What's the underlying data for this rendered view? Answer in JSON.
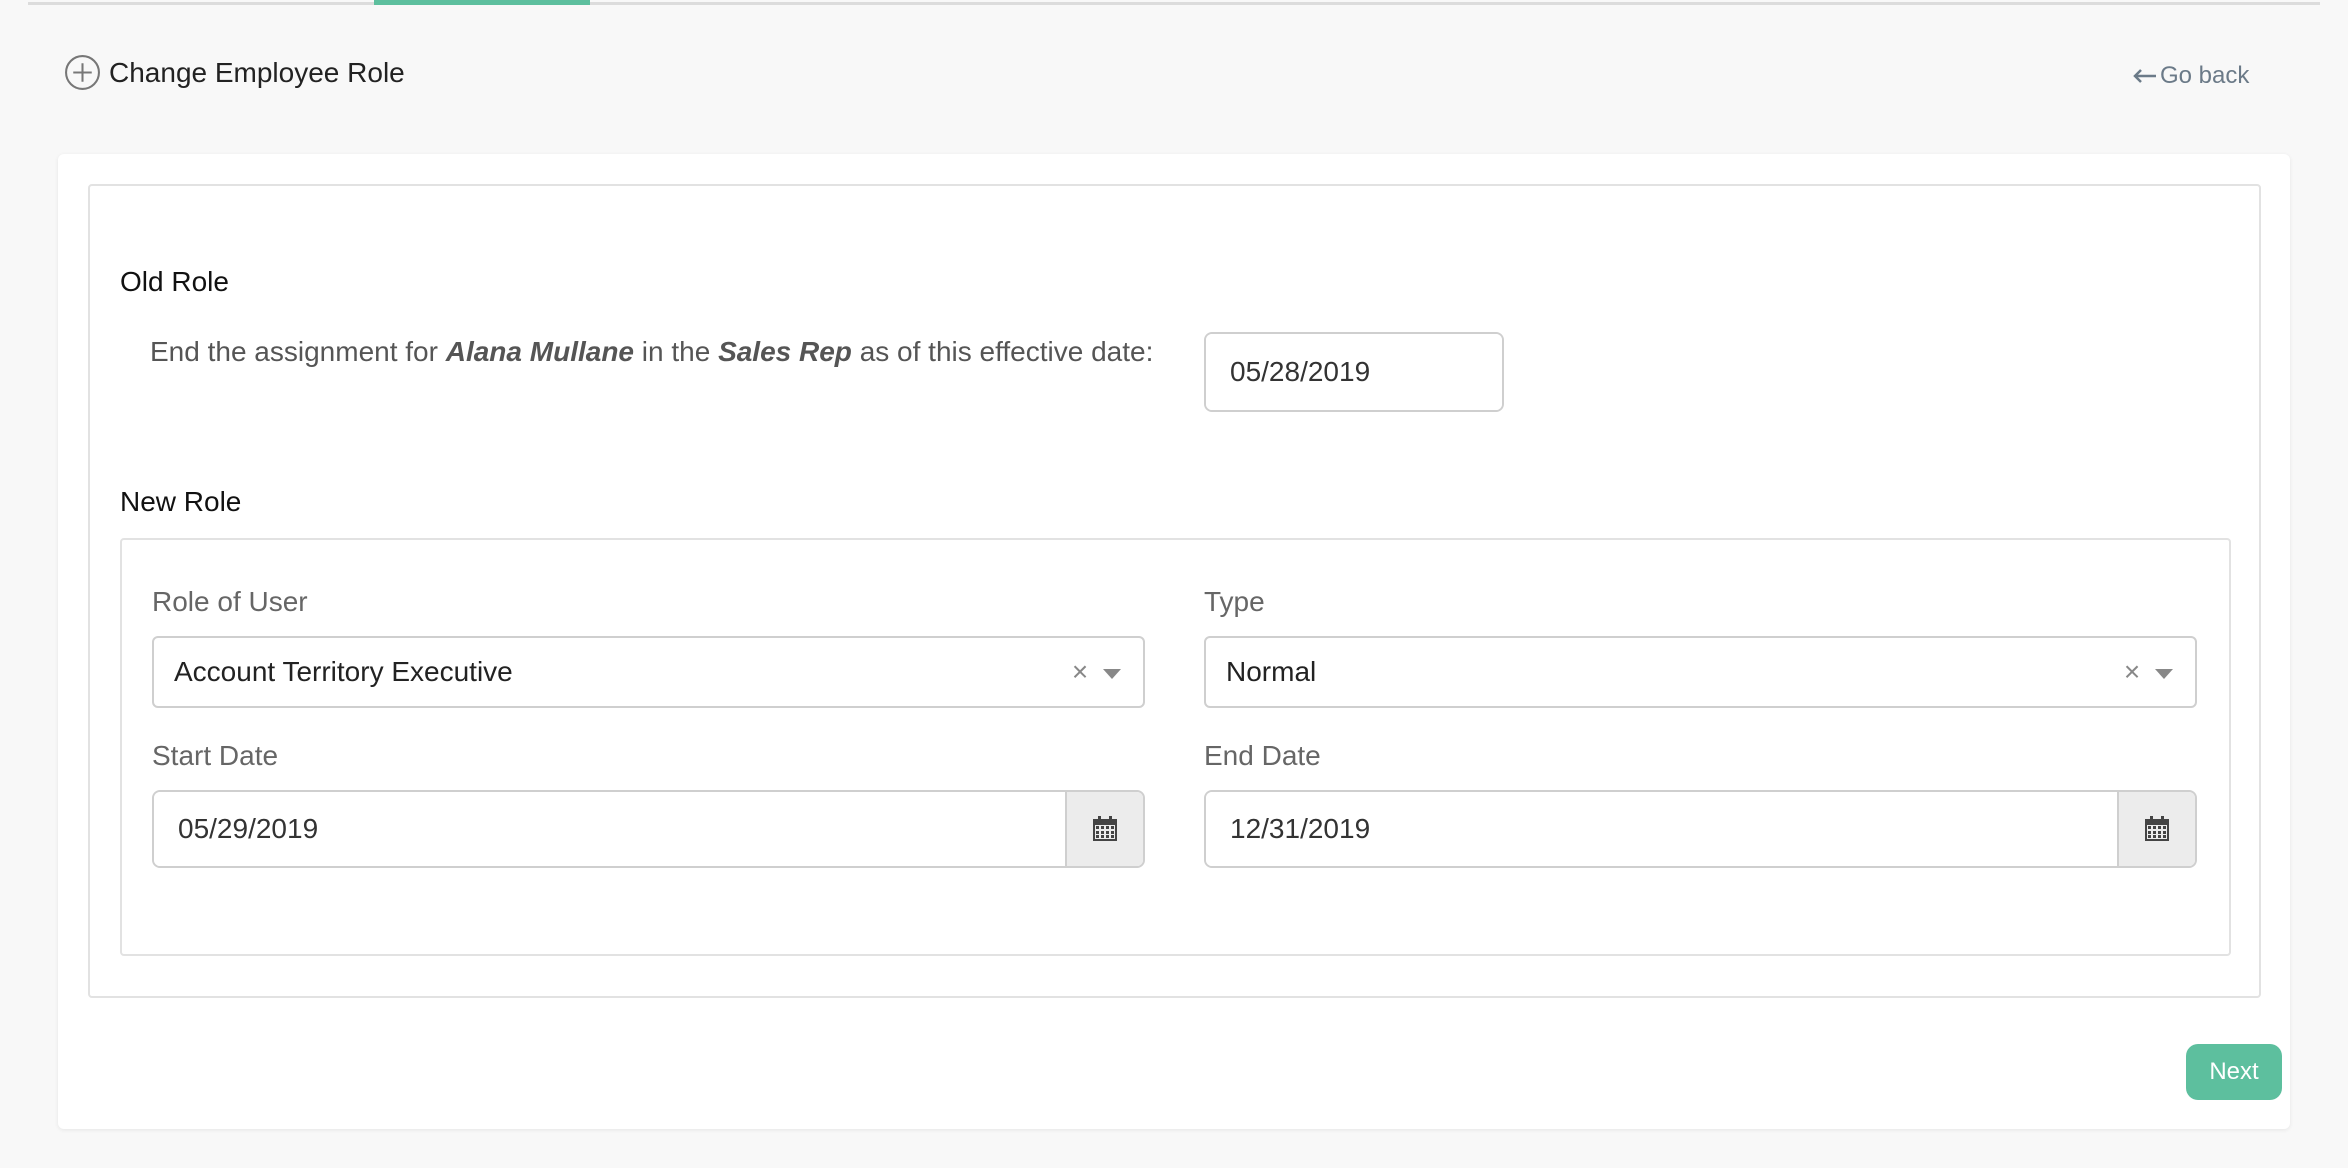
{
  "header": {
    "title": "Change Employee Role",
    "go_back_label": "Go back"
  },
  "old_role": {
    "section_title": "Old Role",
    "text_prefix": "End the assignment for",
    "employee_name": "Alana Mullane",
    "text_middle": "in the",
    "role_name": "Sales Rep",
    "text_suffix": "as of this effective date:",
    "effective_date": "05/28/2019"
  },
  "new_role": {
    "section_title": "New Role",
    "role_of_user": {
      "label": "Role of User",
      "value": "Account Territory Executive"
    },
    "type": {
      "label": "Type",
      "value": "Normal"
    },
    "start_date": {
      "label": "Start Date",
      "value": "05/29/2019"
    },
    "end_date": {
      "label": "End Date",
      "value": "12/31/2019"
    }
  },
  "actions": {
    "next_label": "Next"
  },
  "icons": {
    "header": "plus-circle-icon",
    "go_back": "arrow-left-icon",
    "date_picker": "calendar-icon",
    "clear": "clear-icon",
    "dropdown": "chevron-down-icon"
  },
  "colors": {
    "accent": "#5dbf9e",
    "link": "#6b7a88"
  }
}
